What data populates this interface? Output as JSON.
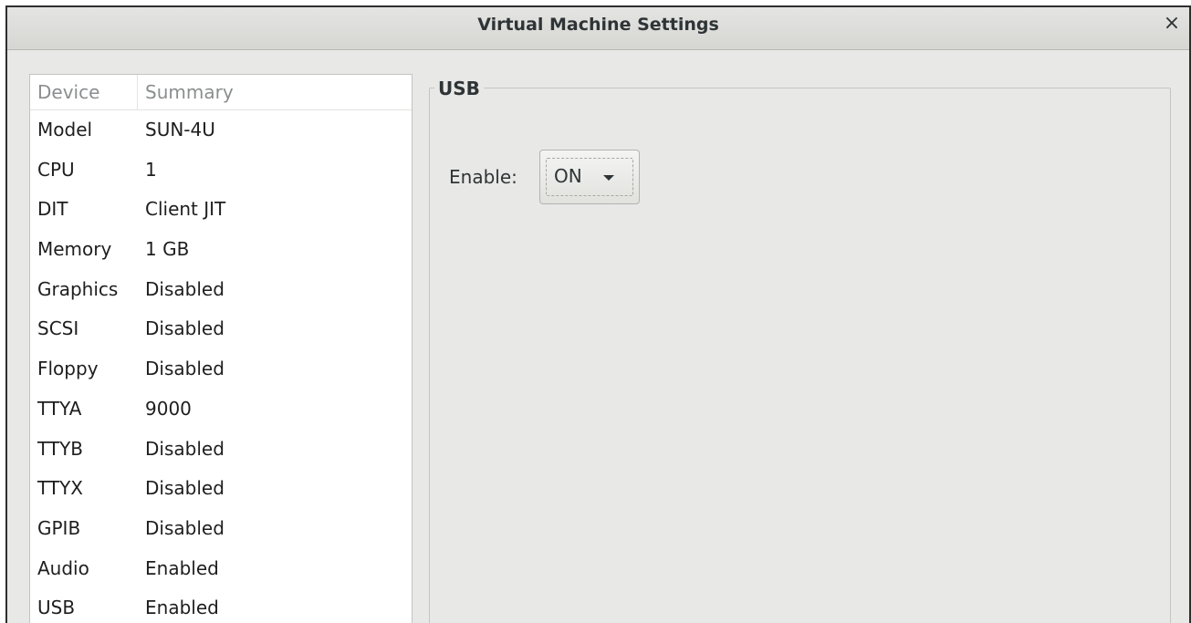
{
  "window": {
    "title": "Virtual Machine Settings",
    "close_glyph": "×"
  },
  "device_list": {
    "headers": {
      "device": "Device",
      "summary": "Summary"
    },
    "rows": [
      {
        "device": "Model",
        "summary": "SUN-4U"
      },
      {
        "device": "CPU",
        "summary": "1"
      },
      {
        "device": "DIT",
        "summary": "Client JIT"
      },
      {
        "device": "Memory",
        "summary": "1 GB"
      },
      {
        "device": "Graphics",
        "summary": "Disabled"
      },
      {
        "device": "SCSI",
        "summary": "Disabled"
      },
      {
        "device": "Floppy",
        "summary": "Disabled"
      },
      {
        "device": "TTYA",
        "summary": "9000"
      },
      {
        "device": "TTYB",
        "summary": "Disabled"
      },
      {
        "device": "TTYX",
        "summary": "Disabled"
      },
      {
        "device": "GPIB",
        "summary": "Disabled"
      },
      {
        "device": "Audio",
        "summary": "Enabled"
      },
      {
        "device": "USB",
        "summary": "Enabled"
      }
    ]
  },
  "usb_panel": {
    "frame_title": "USB",
    "enable_label": "Enable:",
    "enable_value": "ON",
    "arrow_icon": "chevron-down-icon"
  }
}
